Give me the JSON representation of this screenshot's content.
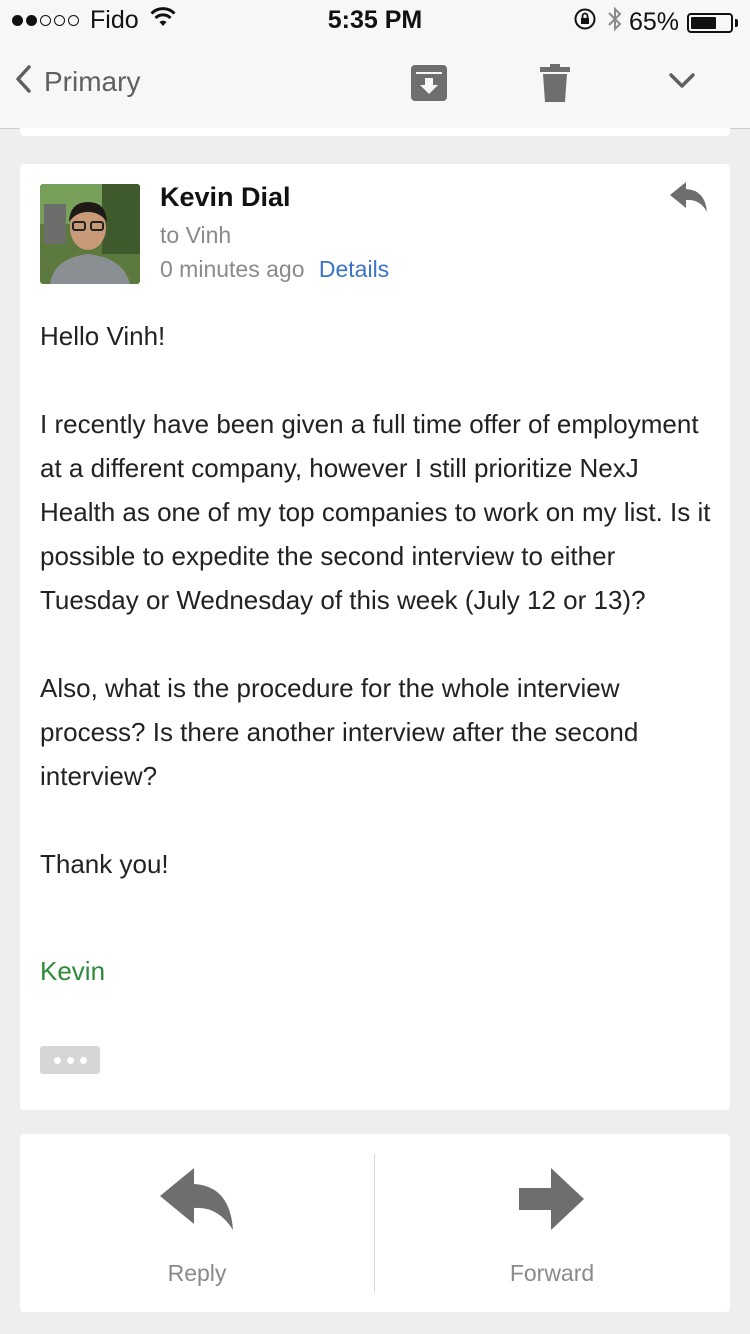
{
  "status_bar": {
    "carrier": "Fido",
    "time": "5:35 PM",
    "battery_percent": "65%",
    "battery_level": 0.65,
    "signal_bars_filled": 2,
    "signal_bars_total": 5,
    "icons": [
      "wifi-icon",
      "orientation-lock-icon",
      "bluetooth-icon",
      "battery-icon"
    ]
  },
  "nav": {
    "back_label": "Primary",
    "icons": [
      "back-chevron-icon",
      "archive-icon",
      "trash-icon",
      "chevron-down-icon"
    ]
  },
  "email": {
    "sender": "Kevin Dial",
    "recipient": "to Vinh",
    "time_ago": "0 minutes ago",
    "details_label": "Details",
    "greeting": "Hello Vinh!",
    "paragraph1": "I recently have been given a full time offer of employment at a different company, however I still prioritize NexJ Health as one of my top companies to work on my list. Is it possible to expedite the second interview to either Tuesday or Wednesday of this week (July 12 or 13)?",
    "paragraph2": "Also, what is the procedure for the whole interview process? Is there another interview after the second interview?",
    "closing": "Thank you!",
    "signature": "Kevin"
  },
  "actions": {
    "reply_label": "Reply",
    "forward_label": "Forward"
  },
  "colors": {
    "link": "#3b73c6",
    "signature": "#2e8b3a",
    "icon_gray": "#6e6e6e",
    "background": "#eeeeee"
  }
}
